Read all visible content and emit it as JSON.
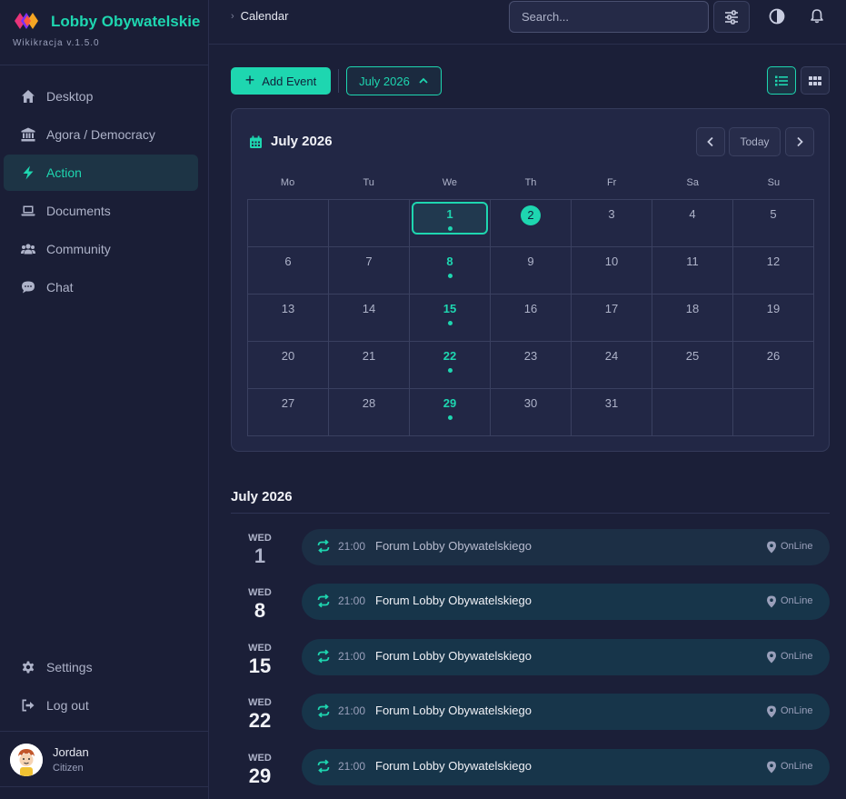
{
  "brand": {
    "title": "Lobby Obywatelskie",
    "version": "Wikikracja v.1.5.0",
    "colors": [
      "#e8347a",
      "#f5a623",
      "#7b2ff7"
    ]
  },
  "sidebar": {
    "items": [
      {
        "label": "Desktop",
        "icon": "home-icon"
      },
      {
        "label": "Agora / Democracy",
        "icon": "landmark-icon"
      },
      {
        "label": "Action",
        "icon": "bolt-icon",
        "active": true
      },
      {
        "label": "Documents",
        "icon": "laptop-icon"
      },
      {
        "label": "Community",
        "icon": "users-icon"
      },
      {
        "label": "Chat",
        "icon": "chat-icon"
      }
    ],
    "bottom_items": [
      {
        "label": "Settings",
        "icon": "gear-icon"
      },
      {
        "label": "Log out",
        "icon": "logout-icon"
      }
    ],
    "user": {
      "name": "Jordan",
      "role": "Citizen"
    }
  },
  "topbar": {
    "breadcrumb": "Calendar",
    "search_placeholder": "Search..."
  },
  "toolbar": {
    "add_event_label": "Add Event",
    "month_label": "July 2026"
  },
  "calendar": {
    "title": "July 2026",
    "today_label": "Today",
    "weekdays": [
      "Mo",
      "Tu",
      "We",
      "Th",
      "Fr",
      "Sa",
      "Su"
    ],
    "weeks": [
      [
        "",
        "",
        "1",
        "2",
        "3",
        "4",
        "5"
      ],
      [
        "6",
        "7",
        "8",
        "9",
        "10",
        "11",
        "12"
      ],
      [
        "13",
        "14",
        "15",
        "16",
        "17",
        "18",
        "19"
      ],
      [
        "20",
        "21",
        "22",
        "23",
        "24",
        "25",
        "26"
      ],
      [
        "27",
        "28",
        "29",
        "30",
        "31",
        "",
        ""
      ]
    ],
    "event_days": [
      "1",
      "8",
      "15",
      "22",
      "29"
    ],
    "selected_day": "1",
    "today_day": "2"
  },
  "events": {
    "month_title": "July 2026",
    "items": [
      {
        "dow": "WED",
        "day": "1",
        "time": "21:00",
        "name": "Forum Lobby Obywatelskiego",
        "location": "OnLine",
        "past": true
      },
      {
        "dow": "WED",
        "day": "8",
        "time": "21:00",
        "name": "Forum Lobby Obywatelskiego",
        "location": "OnLine",
        "past": false
      },
      {
        "dow": "WED",
        "day": "15",
        "time": "21:00",
        "name": "Forum Lobby Obywatelskiego",
        "location": "OnLine",
        "past": false
      },
      {
        "dow": "WED",
        "day": "22",
        "time": "21:00",
        "name": "Forum Lobby Obywatelskiego",
        "location": "OnLine",
        "past": false
      },
      {
        "dow": "WED",
        "day": "29",
        "time": "21:00",
        "name": "Forum Lobby Obywatelskiego",
        "location": "OnLine",
        "past": false
      }
    ]
  },
  "theme": {
    "accent": "#1ed6b0",
    "background": "#1b1f38",
    "card": "#222745"
  }
}
